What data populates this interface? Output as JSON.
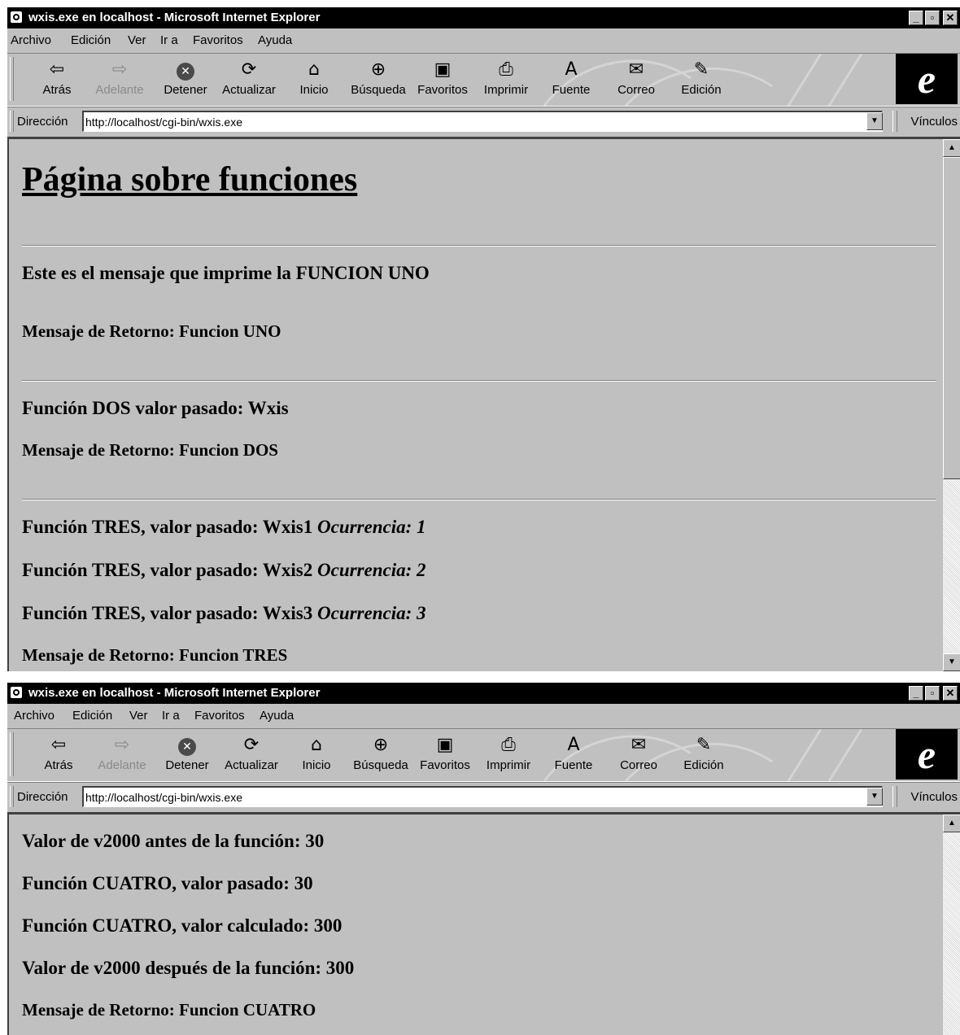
{
  "browser": {
    "title": "wxis.exe en localhost - Microsoft Internet Explorer",
    "menu": [
      "Archivo",
      "Edición",
      "Ver",
      "Ir a",
      "Favoritos",
      "Ayuda"
    ],
    "toolbar": {
      "back": "Atrás",
      "forward": "Adelante",
      "stop": "Detener",
      "refresh": "Actualizar",
      "home": "Inicio",
      "search": "Búsqueda",
      "favorites": "Favoritos",
      "print": "Imprimir",
      "font": "Fuente",
      "mail": "Correo",
      "edit": "Edición"
    },
    "address_label": "Dirección",
    "address_value": "http://localhost/cgi-bin/wxis.exe",
    "links_label": "Vínculos"
  },
  "window1": {
    "heading": "Página sobre funciones",
    "f1_message": "Este es el mensaje que imprime la FUNCION UNO",
    "f1_return": "Mensaje de Retorno: Funcion UNO",
    "f2_message": "Función DOS valor pasado: Wxis",
    "f2_return": "Mensaje de Retorno: Funcion DOS",
    "f3_lines": [
      {
        "text": "Función TRES, valor pasado: Wxis1 ",
        "occ": "Ocurrencia: 1"
      },
      {
        "text": "Función TRES, valor pasado: Wxis2 ",
        "occ": "Ocurrencia: 2"
      },
      {
        "text": "Función TRES, valor pasado: Wxis3 ",
        "occ": "Ocurrencia: 3"
      }
    ],
    "f3_return": "Mensaje de Retorno: Funcion TRES"
  },
  "window2": {
    "lines": [
      "Valor de v2000 antes de la función: 30",
      "Función CUATRO, valor pasado: 30",
      "Función CUATRO, valor calculado: 300",
      "Valor de v2000 después de la función: 300"
    ],
    "f4_return": "Mensaje de Retorno: Funcion CUATRO"
  }
}
